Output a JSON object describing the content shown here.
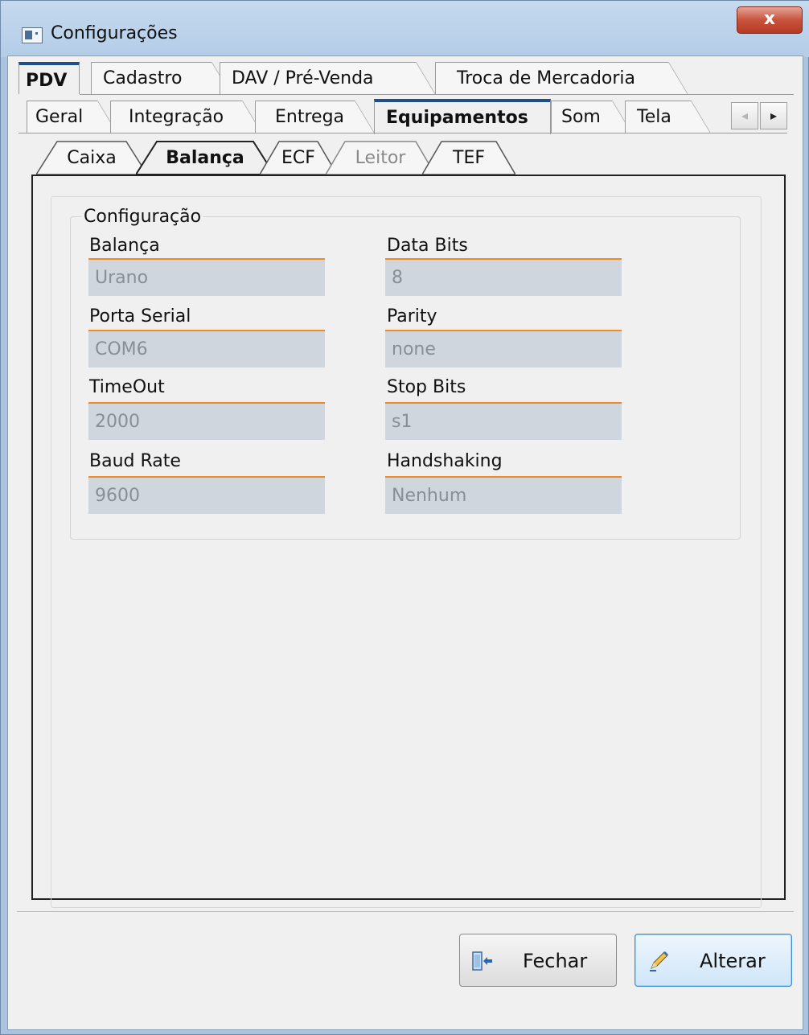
{
  "window": {
    "title": "Configurações",
    "close_label": "x"
  },
  "tabs_top": [
    "PDV",
    "Cadastro",
    "DAV / Pré-Venda",
    "Troca de Mercadoria"
  ],
  "tabs_second": [
    "Geral",
    "Integração",
    "Entrega",
    "Equipamentos",
    "Som",
    "Tela"
  ],
  "subtabs": [
    "Caixa",
    "Balança",
    "ECF",
    "Leitor",
    "TEF"
  ],
  "scroll": {
    "left": "◂",
    "right": "▸"
  },
  "group": {
    "title": "Configuração",
    "fields": {
      "balanca": {
        "label": "Balança",
        "value": "Urano"
      },
      "porta_serial": {
        "label": "Porta Serial",
        "value": "COM6"
      },
      "timeout": {
        "label": "TimeOut",
        "value": "2000"
      },
      "baud_rate": {
        "label": "Baud Rate",
        "value": "9600"
      },
      "data_bits": {
        "label": "Data Bits",
        "value": "8"
      },
      "parity": {
        "label": "Parity",
        "value": "none"
      },
      "stop_bits": {
        "label": "Stop Bits",
        "value": "s1"
      },
      "handshaking": {
        "label": "Handshaking",
        "value": "Nenhum"
      }
    }
  },
  "buttons": {
    "fechar": "Fechar",
    "alterar": "Alterar"
  },
  "colors": {
    "field_accent": "#f08a24",
    "field_bg": "#cfd6de",
    "active_tab_top": "#1f4f86"
  }
}
